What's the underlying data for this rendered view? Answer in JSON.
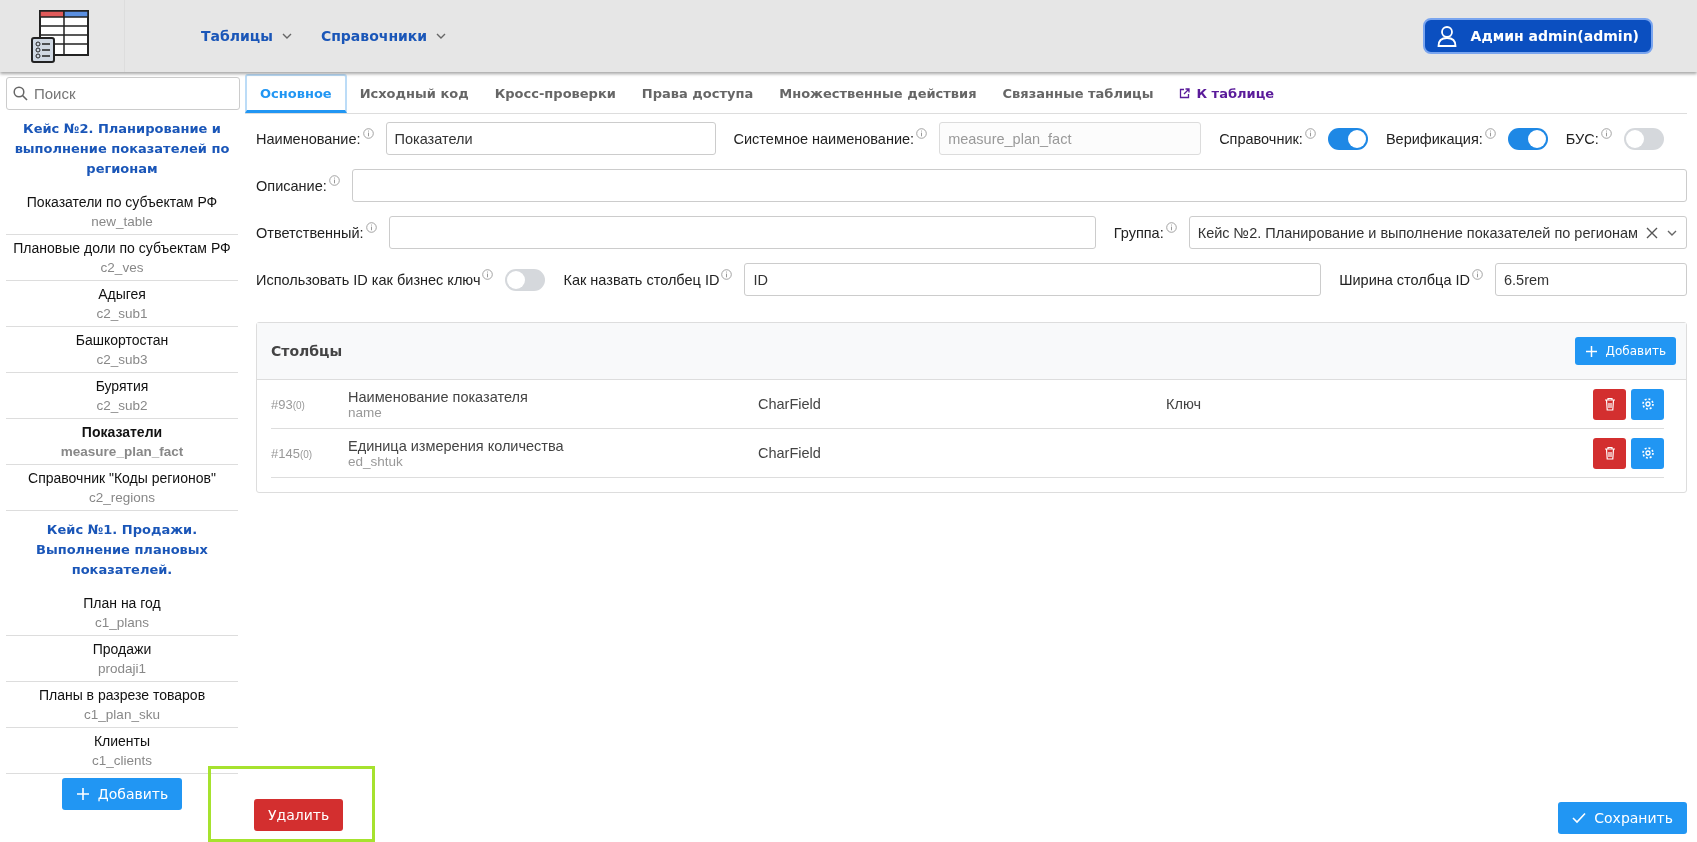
{
  "header": {
    "nav": [
      {
        "label": "Таблицы"
      },
      {
        "label": "Справочники"
      }
    ],
    "user": "Админ admin(admin)"
  },
  "sidebar": {
    "search": {
      "placeholder": "Поиск"
    },
    "groups": [
      {
        "title": "Кейс №2. Планирование и выполнение показателей по регионам",
        "items": [
          {
            "title": "Показатели по субъектам РФ",
            "name": "new_table",
            "selected": false
          },
          {
            "title": "Плановые доли по субъектам РФ",
            "name": "c2_ves",
            "selected": false
          },
          {
            "title": "Адыгея",
            "name": "c2_sub1",
            "selected": false
          },
          {
            "title": "Башкортостан",
            "name": "c2_sub3",
            "selected": false
          },
          {
            "title": "Бурятия",
            "name": "c2_sub2",
            "selected": false
          },
          {
            "title": "Показатели",
            "name": "measure_plan_fact",
            "selected": true
          },
          {
            "title": "Справочник \"Коды регионов\"",
            "name": "c2_regions",
            "selected": false
          }
        ]
      },
      {
        "title": "Кейс №1. Продажи. Выполнение плановых показателей.",
        "items": [
          {
            "title": "План на год",
            "name": "c1_plans",
            "selected": false
          },
          {
            "title": "Продажи",
            "name": "prodaji1",
            "selected": false
          },
          {
            "title": "Планы в разрезе товаров",
            "name": "c1_plan_sku",
            "selected": false
          },
          {
            "title": "Клиенты",
            "name": "c1_clients",
            "selected": false
          }
        ]
      }
    ],
    "add_button": "Добавить"
  },
  "tabs": [
    {
      "label": "Основное",
      "selected": true,
      "kind": "tab"
    },
    {
      "label": "Исходный код",
      "selected": false,
      "kind": "tab"
    },
    {
      "label": "Кросс-проверки",
      "selected": false,
      "kind": "tab"
    },
    {
      "label": "Права доступа",
      "selected": false,
      "kind": "tab"
    },
    {
      "label": "Множественные действия",
      "selected": false,
      "kind": "tab"
    },
    {
      "label": "Связанные таблицы",
      "selected": false,
      "kind": "tab"
    },
    {
      "label": "К таблице",
      "selected": false,
      "kind": "link"
    }
  ],
  "form": {
    "rows": [
      {
        "fields": [
          {
            "kind": "input",
            "label": "Наименование:",
            "value": "Показатели",
            "disabled": false
          },
          {
            "kind": "input",
            "label": "Системное наименование:",
            "value": "measure_plan_fact",
            "disabled": true
          },
          {
            "kind": "toggle",
            "label": "Справочник:",
            "on": true
          },
          {
            "kind": "toggle",
            "label": "Верификация:",
            "on": true
          },
          {
            "kind": "toggle",
            "label": "БУС:",
            "on": false
          }
        ]
      },
      {
        "fields": [
          {
            "kind": "input",
            "label": "Описание:",
            "disabled": false
          }
        ]
      },
      {
        "fields": [
          {
            "kind": "input",
            "label": "Ответственный:",
            "disabled": false
          },
          {
            "kind": "select",
            "label": "Группа:",
            "value": "Кейс №2. Планирование и выполнение показателей по регионам"
          }
        ]
      },
      {
        "fields": [
          {
            "kind": "toggle",
            "label": "Использовать ID как бизнес ключ",
            "on": false
          },
          {
            "kind": "input",
            "label": "Как назвать столбец ID",
            "value": "ID",
            "disabled": false
          },
          {
            "kind": "input",
            "label": "Ширина столбца ID",
            "value": "6.5rem",
            "disabled": false
          }
        ]
      }
    ]
  },
  "columns_panel": {
    "title": "Столбцы",
    "add_button": "Добавить",
    "rows": [
      {
        "id": "#93",
        "count": "(0)",
        "title": "Наименование показателя",
        "name": "name",
        "type": "CharField",
        "note": "Ключ"
      },
      {
        "id": "#145",
        "count": "(0)",
        "title": "Единица измерения количества",
        "name": "ed_shtuk",
        "type": "CharField"
      }
    ]
  },
  "footer": {
    "delete_button": "Удалить",
    "save_button": "Сохранить"
  }
}
